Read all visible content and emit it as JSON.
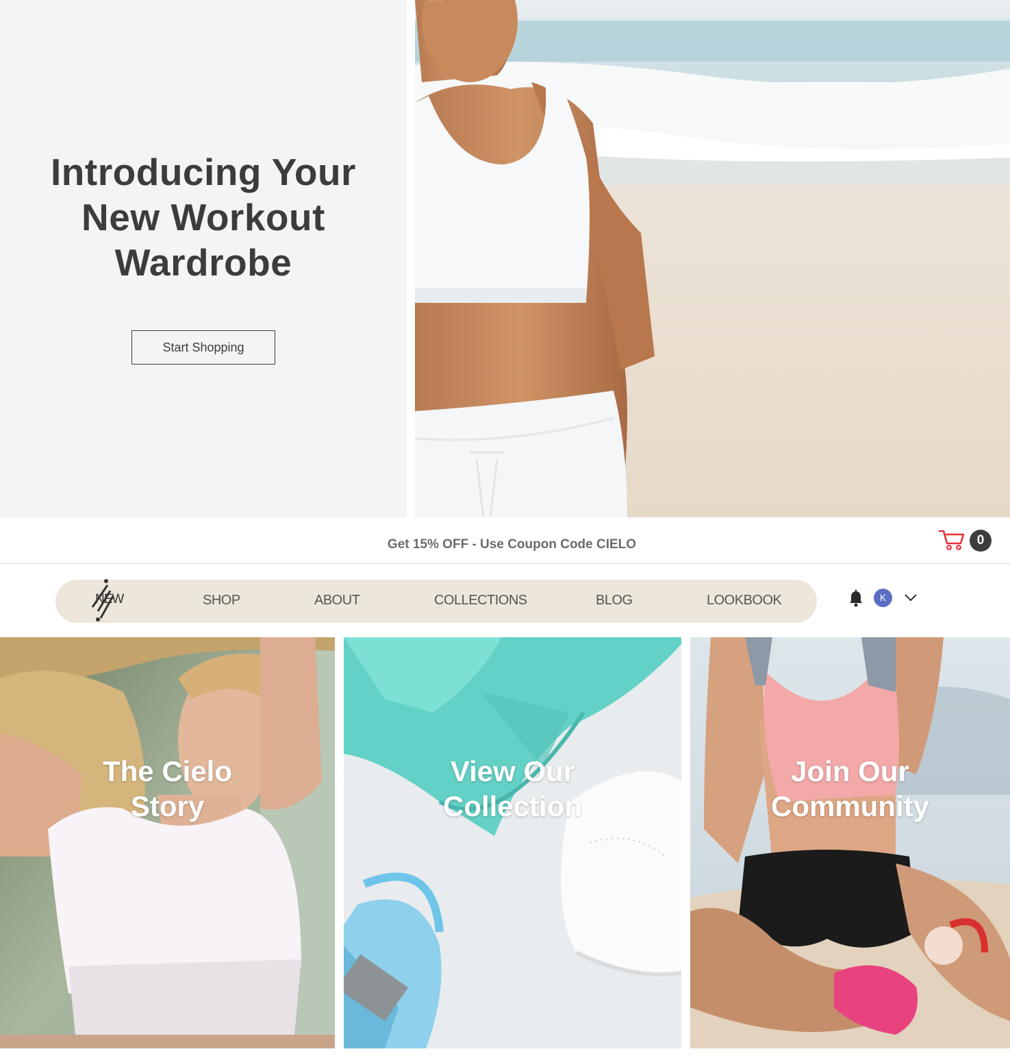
{
  "hero": {
    "title_lines": [
      "Introducing Your",
      "New Workout",
      "Wardrobe"
    ],
    "button_label": "Start Shopping"
  },
  "announcement": {
    "text": "Get 15% OFF - Use Coupon Code CIELO"
  },
  "cart": {
    "count": "0",
    "icon": "shopping-cart-icon",
    "icon_color": "#e8323a"
  },
  "nav": {
    "logo_text": "NEW",
    "items": [
      "SHOP",
      "ABOUT",
      "COLLECTIONS",
      "BLOG",
      "LOOKBOOK"
    ],
    "background": "#ede6da"
  },
  "user": {
    "avatar_initial": "K",
    "avatar_color": "#5a6fc4",
    "bell_icon": "bell-icon",
    "dropdown_icon": "chevron-down-icon"
  },
  "tiles": [
    {
      "lines": [
        "The Cielo",
        "Story"
      ]
    },
    {
      "lines": [
        "View Our",
        "Collection"
      ]
    },
    {
      "lines": [
        "Join Our",
        "Community"
      ]
    }
  ]
}
